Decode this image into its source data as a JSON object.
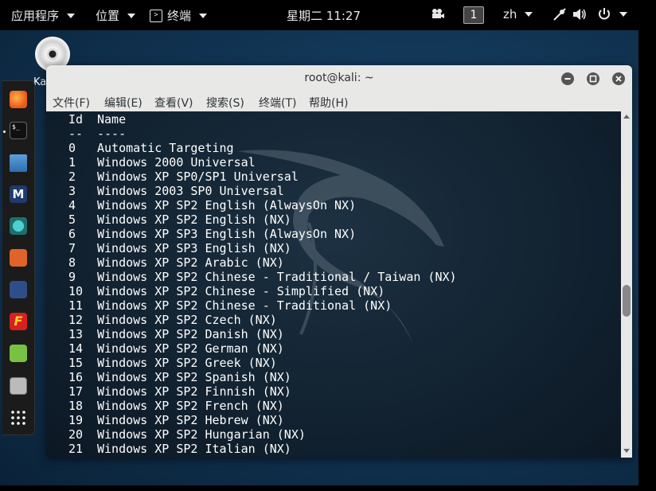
{
  "topbar": {
    "applications": "应用程序",
    "places": "位置",
    "terminal_app": "终端",
    "clock": "星期二 11:27",
    "workspace": "1",
    "language": "zh"
  },
  "desktop": {
    "icon_label": "Ka"
  },
  "dock": {
    "icons": [
      "firefox-icon",
      "terminal-icon",
      "files-icon",
      "metasploit-icon",
      "armitage-icon",
      "burpsuite-icon",
      "maltego-icon",
      "faraday-icon",
      "leafpad-icon",
      "keyboard-icon",
      "app-grid-icon"
    ]
  },
  "window": {
    "title": "root@kali: ~",
    "menu": [
      "文件(F)",
      "编辑(E)",
      "查看(V)",
      "搜索(S)",
      "终端(T)",
      "帮助(H)"
    ]
  },
  "terminal": {
    "header": {
      "id": "Id",
      "name": "Name"
    },
    "separator": {
      "id": "--",
      "name": "----"
    },
    "rows": [
      {
        "id": "0",
        "name": "Automatic Targeting"
      },
      {
        "id": "1",
        "name": "Windows 2000 Universal"
      },
      {
        "id": "2",
        "name": "Windows XP SP0/SP1 Universal"
      },
      {
        "id": "3",
        "name": "Windows 2003 SP0 Universal"
      },
      {
        "id": "4",
        "name": "Windows XP SP2 English (AlwaysOn NX)"
      },
      {
        "id": "5",
        "name": "Windows XP SP2 English (NX)"
      },
      {
        "id": "6",
        "name": "Windows XP SP3 English (AlwaysOn NX)"
      },
      {
        "id": "7",
        "name": "Windows XP SP3 English (NX)"
      },
      {
        "id": "8",
        "name": "Windows XP SP2 Arabic (NX)"
      },
      {
        "id": "9",
        "name": "Windows XP SP2 Chinese - Traditional / Taiwan (NX)"
      },
      {
        "id": "10",
        "name": "Windows XP SP2 Chinese - Simplified (NX)"
      },
      {
        "id": "11",
        "name": "Windows XP SP2 Chinese - Traditional (NX)"
      },
      {
        "id": "12",
        "name": "Windows XP SP2 Czech (NX)"
      },
      {
        "id": "13",
        "name": "Windows XP SP2 Danish (NX)"
      },
      {
        "id": "14",
        "name": "Windows XP SP2 German (NX)"
      },
      {
        "id": "15",
        "name": "Windows XP SP2 Greek (NX)"
      },
      {
        "id": "16",
        "name": "Windows XP SP2 Spanish (NX)"
      },
      {
        "id": "17",
        "name": "Windows XP SP2 Finnish (NX)"
      },
      {
        "id": "18",
        "name": "Windows XP SP2 French (NX)"
      },
      {
        "id": "19",
        "name": "Windows XP SP2 Hebrew (NX)"
      },
      {
        "id": "20",
        "name": "Windows XP SP2 Hungarian (NX)"
      },
      {
        "id": "21",
        "name": "Windows XP SP2 Italian (NX)"
      }
    ]
  }
}
